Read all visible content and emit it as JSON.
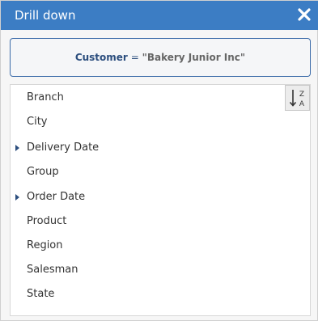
{
  "dialog": {
    "title": "Drill down",
    "close_icon": "close-icon"
  },
  "filter": {
    "field": "Customer",
    "operator": "=",
    "value": "\"Bakery Junior Inc\""
  },
  "sort": {
    "icon": "sort-z-a-icon",
    "top_letter": "Z",
    "bottom_letter": "A"
  },
  "fields": [
    {
      "label": "Branch",
      "expandable": false
    },
    {
      "label": "City",
      "expandable": false
    },
    {
      "label": "Delivery Date",
      "expandable": true
    },
    {
      "label": "Group",
      "expandable": false
    },
    {
      "label": "Order Date",
      "expandable": true
    },
    {
      "label": "Product",
      "expandable": false
    },
    {
      "label": "Region",
      "expandable": false
    },
    {
      "label": "Salesman",
      "expandable": false
    },
    {
      "label": "State",
      "expandable": false
    }
  ],
  "colors": {
    "titlebar": "#3c7dc4",
    "accent": "#2c4e7e"
  }
}
